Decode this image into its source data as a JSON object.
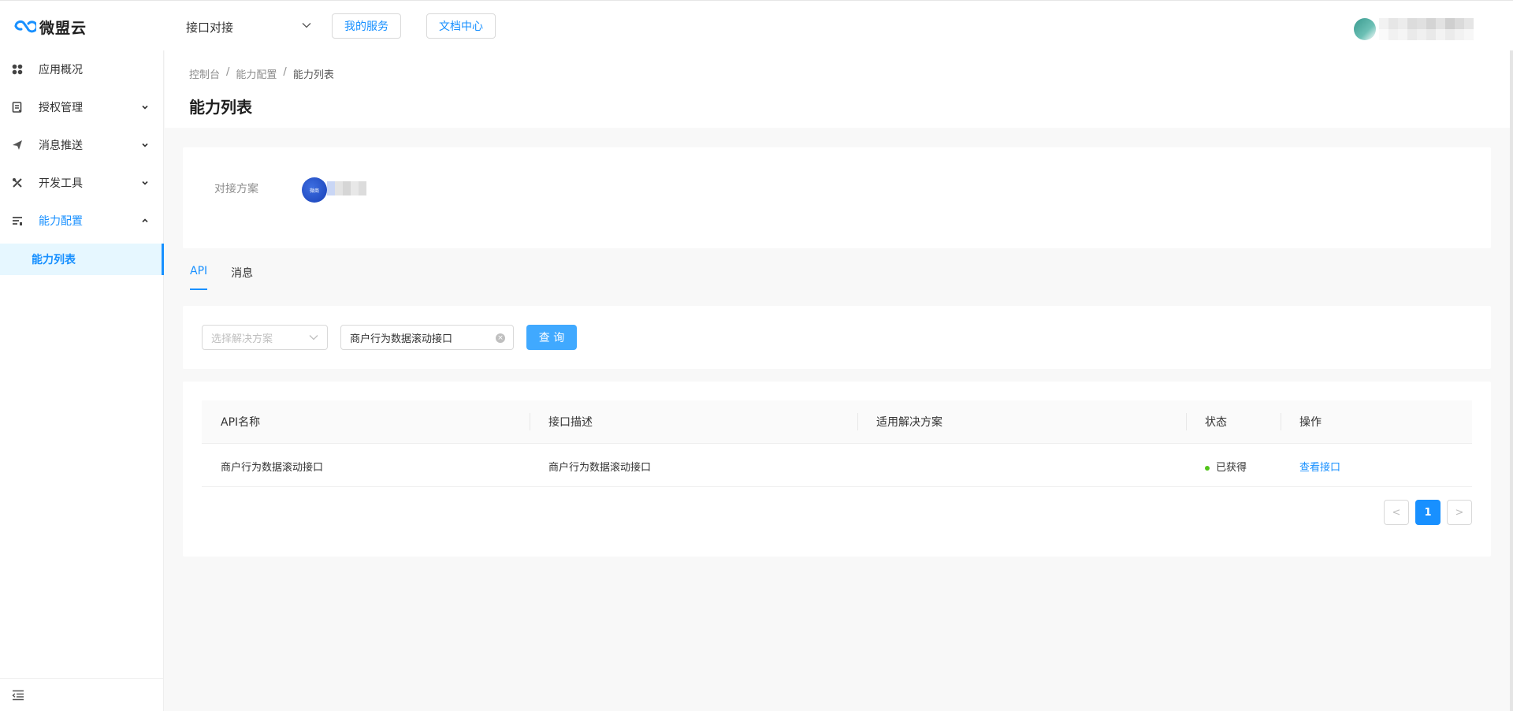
{
  "header": {
    "logo_text": "微盟云",
    "select_value": "接口对接",
    "my_services": "我的服务",
    "doc_center": "文档中心"
  },
  "sidebar": {
    "items": [
      {
        "label": "应用概况",
        "icon": "app-overview-icon"
      },
      {
        "label": "授权管理",
        "icon": "auth-doc-icon"
      },
      {
        "label": "消息推送",
        "icon": "paper-plane-icon"
      },
      {
        "label": "开发工具",
        "icon": "tools-icon"
      },
      {
        "label": "能力配置",
        "icon": "config-list-icon"
      }
    ],
    "sub_item": "能力列表"
  },
  "breadcrumb": {
    "items": [
      "控制台",
      "能力配置",
      "能力列表"
    ],
    "separator": "/"
  },
  "page_title": "能力列表",
  "plan": {
    "label": "对接方案",
    "logo_text": "微商"
  },
  "tabs": [
    {
      "label": "API",
      "active": true
    },
    {
      "label": "消息",
      "active": false
    }
  ],
  "filter": {
    "select_placeholder": "选择解决方案",
    "search_value": "商户行为数据滚动接口",
    "query_button": "查 询"
  },
  "table": {
    "columns": [
      "API名称",
      "接口描述",
      "适用解决方案",
      "状态",
      "操作"
    ],
    "rows": [
      {
        "name": "商户行为数据滚动接口",
        "description": "商户行为数据滚动接口",
        "solution": "",
        "status": "已获得",
        "action": "查看接口"
      }
    ]
  },
  "pagination": {
    "prev": "<",
    "current": "1",
    "next": ">"
  },
  "colors": {
    "primary": "#1890ff",
    "success": "#52c41a",
    "query_button": "#40a9ff"
  }
}
